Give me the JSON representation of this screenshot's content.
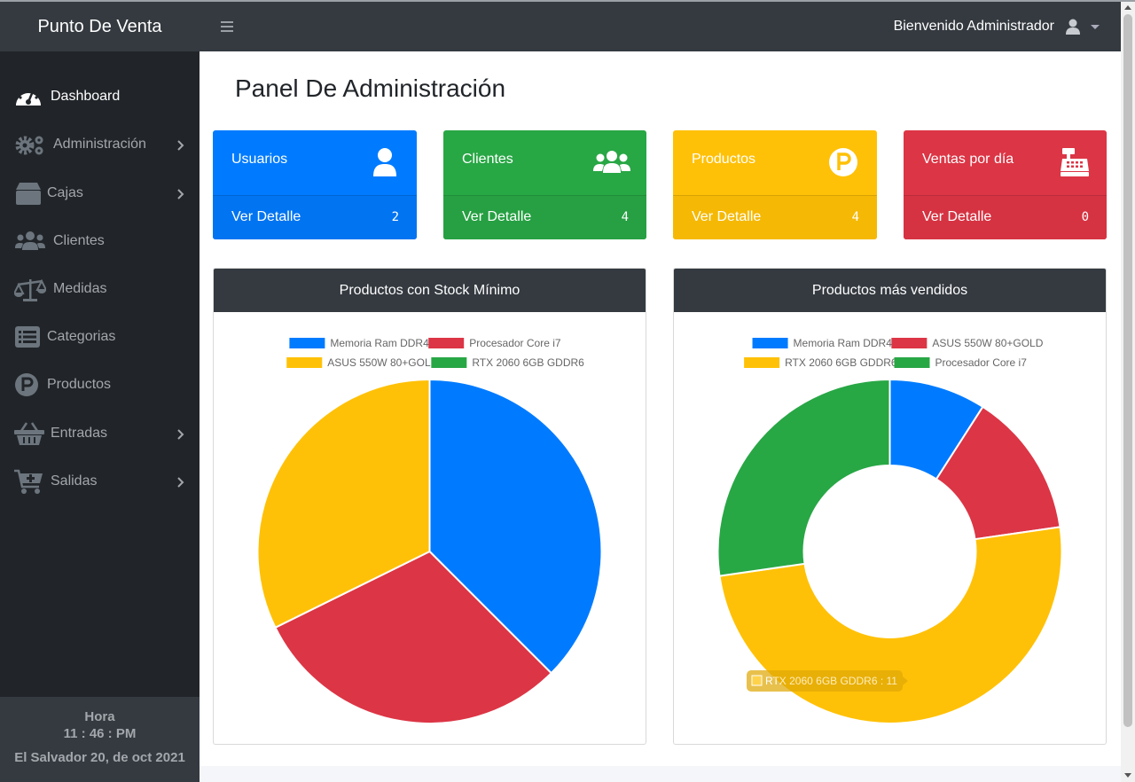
{
  "topbar": {
    "brand": "Punto De Venta",
    "menu_icon": "hamburger-icon",
    "welcome": "Bienvenido Administrador",
    "user_icon": "user-icon"
  },
  "sidebar": {
    "items": [
      {
        "label": "Dashboard",
        "icon": "tachometer-icon",
        "active": true,
        "has_submenu": false
      },
      {
        "label": "Administración",
        "icon": "gears-icon",
        "active": false,
        "has_submenu": true
      },
      {
        "label": "Cajas",
        "icon": "box-icon",
        "active": false,
        "has_submenu": true
      },
      {
        "label": "Clientes",
        "icon": "users-icon",
        "active": false,
        "has_submenu": false
      },
      {
        "label": "Medidas",
        "icon": "balance-scale-icon",
        "active": false,
        "has_submenu": false
      },
      {
        "label": "Categorias",
        "icon": "list-icon",
        "active": false,
        "has_submenu": false
      },
      {
        "label": "Productos",
        "icon": "parking-icon",
        "active": false,
        "has_submenu": false
      },
      {
        "label": "Entradas",
        "icon": "basket-icon",
        "active": false,
        "has_submenu": true
      },
      {
        "label": "Salidas",
        "icon": "cart-plus-icon",
        "active": false,
        "has_submenu": true
      }
    ],
    "footer": {
      "hora_label": "Hora",
      "time": "11 : 46 : PM",
      "date": "El Salvador 20, de oct 2021"
    }
  },
  "main": {
    "title": "Panel De Administración",
    "cards": [
      {
        "title": "Usuarios",
        "link": "Ver Detalle",
        "count": "2",
        "icon": "user-icon",
        "color": "#007bff",
        "footer_color": "#0074f1"
      },
      {
        "title": "Clientes",
        "link": "Ver Detalle",
        "count": "4",
        "icon": "users-icon",
        "color": "#28a745",
        "footer_color": "#26a042"
      },
      {
        "title": "Productos",
        "link": "Ver Detalle",
        "count": "4",
        "icon": "parking-icon",
        "color": "#ffc107",
        "footer_color": "#f5b905"
      },
      {
        "title": "Ventas por día",
        "link": "Ver Detalle",
        "count": "0",
        "icon": "cash-register-icon",
        "color": "#dc3545",
        "footer_color": "#d53342"
      }
    ]
  },
  "chart_data": [
    {
      "type": "pie",
      "title": "Productos con Stock Mínimo",
      "legend_position": "top",
      "categories": [
        "Memoria Ram DDR4",
        "Procesador Core i7",
        "ASUS 550W 80+GOLD",
        "RTX 2060 6GB GDDR6"
      ],
      "values": [
        36,
        29,
        31,
        0
      ],
      "colors": [
        "#007bff",
        "#dc3545",
        "#ffc107",
        "#28a745"
      ]
    },
    {
      "type": "doughnut",
      "title": "Productos más vendidos",
      "legend_position": "top",
      "categories": [
        "Memoria Ram DDR4",
        "ASUS 550W 80+GOLD",
        "RTX 2060 6GB GDDR6",
        "Procesador Core i7"
      ],
      "values": [
        2,
        3,
        11,
        6
      ],
      "colors": [
        "#007bff",
        "#dc3545",
        "#ffc107",
        "#28a745"
      ],
      "tooltip": "RTX 2060 6GB GDDR6 : 11"
    }
  ]
}
